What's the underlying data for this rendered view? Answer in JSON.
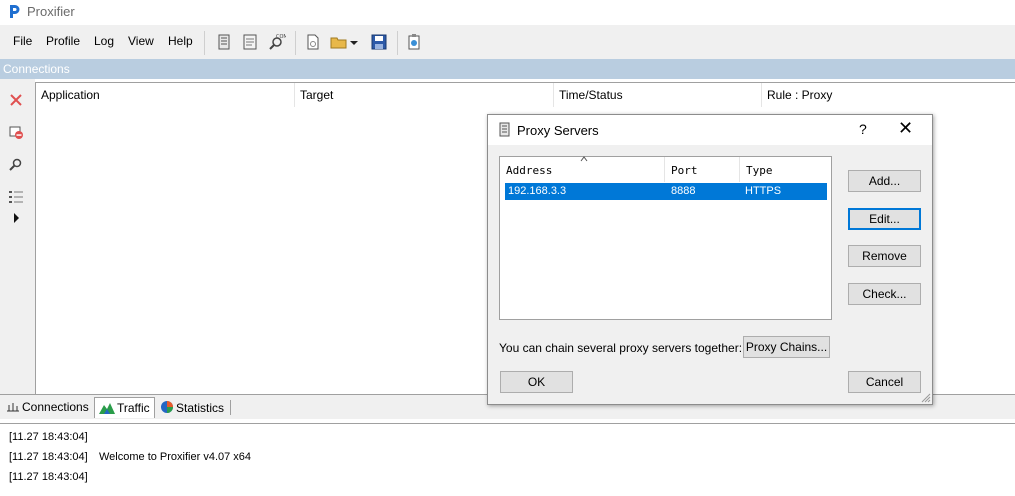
{
  "app": {
    "title": "Proxifier",
    "accent": "#0078d7"
  },
  "menu": [
    "File",
    "Profile",
    "Log",
    "View",
    "Help"
  ],
  "toolbar_icons": [
    "proxy-servers-icon",
    "proxification-rules-icon",
    "name-resolution-icon",
    "new-profile-icon",
    "open-profile-icon",
    "save-profile-icon",
    "advanced-settings-icon"
  ],
  "connections_panel": {
    "title": "Connections",
    "columns": [
      "Application",
      "Target",
      "Time/Status",
      "Rule : Proxy"
    ]
  },
  "left_toolbar_icons": [
    "close-connection-icon",
    "remove-icon",
    "find-icon",
    "tree-view-icon",
    "expand-arrow-icon"
  ],
  "bottom_tabs": [
    "Connections",
    "Traffic",
    "Statistics"
  ],
  "log": [
    {
      "time": "[11.27 18:43:04]",
      "message": ""
    },
    {
      "time": "[11.27 18:43:04]",
      "message": "Welcome to Proxifier v4.07 x64"
    },
    {
      "time": "[11.27 18:43:04]",
      "message": ""
    }
  ],
  "dialog": {
    "title": "Proxy Servers",
    "help": "?",
    "close": "✕",
    "columns": [
      "Address",
      "Port",
      "Type"
    ],
    "rows": [
      {
        "address": "192.168.3.3",
        "port": "8888",
        "type": "HTTPS"
      }
    ],
    "buttons": {
      "add": "Add...",
      "edit": "Edit...",
      "remove": "Remove",
      "check": "Check...",
      "proxy_chains": "Proxy Chains...",
      "ok": "OK",
      "cancel": "Cancel"
    },
    "chain_text": "You can chain several proxy servers together:"
  }
}
